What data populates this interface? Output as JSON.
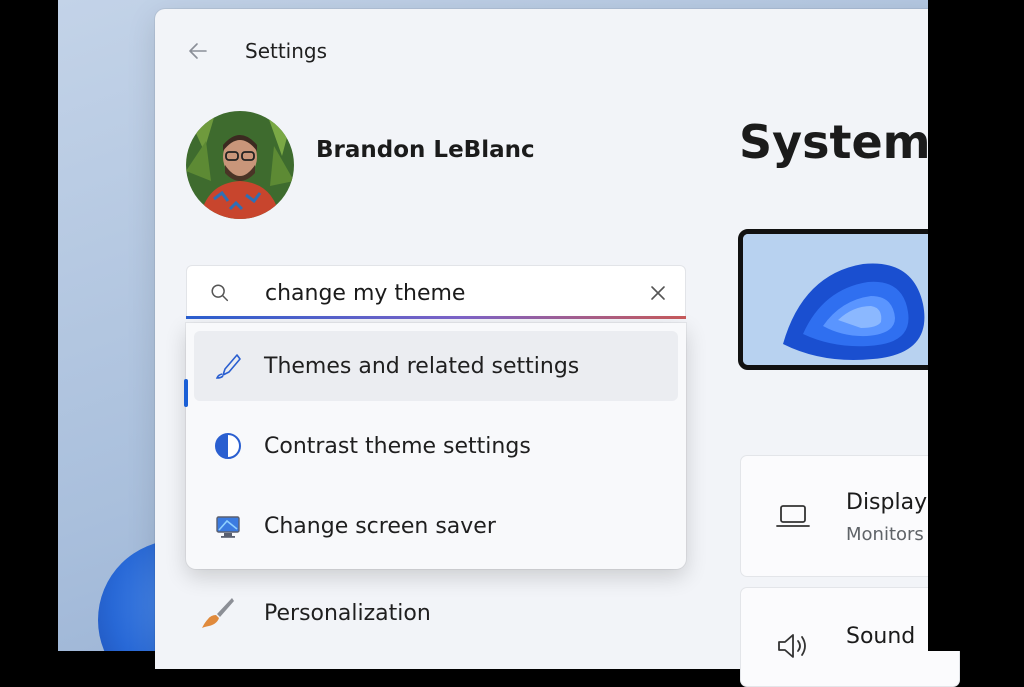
{
  "window": {
    "title": "Settings"
  },
  "profile": {
    "name": "Brandon LeBlanc"
  },
  "search": {
    "value": "change my theme",
    "suggestions": [
      {
        "label": "Themes and related settings",
        "icon": "brush-icon"
      },
      {
        "label": "Contrast theme settings",
        "icon": "contrast-icon"
      },
      {
        "label": "Change screen saver",
        "icon": "screen-saver-icon"
      }
    ]
  },
  "nav": {
    "personalization_label": "Personalization"
  },
  "main": {
    "page_title": "System",
    "cards": [
      {
        "title": "Display",
        "subtitle": "Monitors",
        "icon": "laptop-icon"
      },
      {
        "title": "Sound",
        "subtitle": "",
        "icon": "speaker-icon"
      }
    ]
  },
  "colors": {
    "accent": "#1a5fd6",
    "window_bg": "#f2f4f8"
  }
}
